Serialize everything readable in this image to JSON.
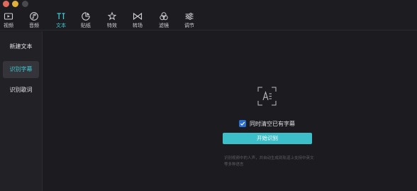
{
  "toolbar": {
    "items": [
      {
        "label": "视频",
        "icon": "video-icon"
      },
      {
        "label": "音频",
        "icon": "audio-icon"
      },
      {
        "label": "文本",
        "icon": "text-icon",
        "active": true
      },
      {
        "label": "贴纸",
        "icon": "sticker-icon"
      },
      {
        "label": "特效",
        "icon": "effects-icon"
      },
      {
        "label": "转场",
        "icon": "transition-icon"
      },
      {
        "label": "滤镜",
        "icon": "filter-icon"
      },
      {
        "label": "调节",
        "icon": "adjust-icon"
      }
    ]
  },
  "sidebar": {
    "items": [
      {
        "label": "新建文本"
      },
      {
        "label": "识别字幕",
        "active": true
      },
      {
        "label": "识别歌词"
      }
    ]
  },
  "main": {
    "checkbox_label": "同时清空已有字幕",
    "checkbox_checked": true,
    "start_button": "开始识别",
    "hint": "识别视频中的人声，并自动生成到轨道上支持中英文等多种语言"
  },
  "colors": {
    "accent": "#3ec9d3",
    "button": "#3dbfca",
    "checkbox": "#2a6fd6",
    "background": "#1c1c20"
  }
}
